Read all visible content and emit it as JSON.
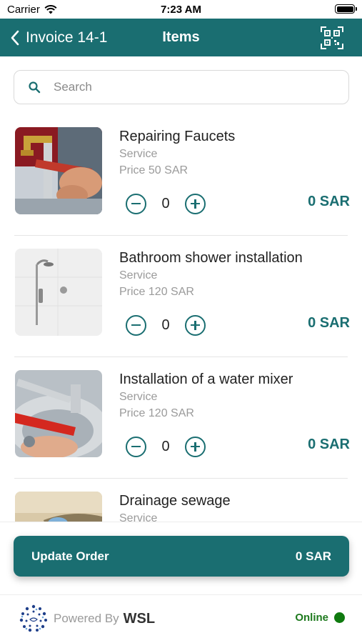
{
  "status_bar": {
    "carrier": "Carrier",
    "time": "7:23 AM"
  },
  "nav": {
    "back_label": "Invoice 14-1",
    "title": "Items"
  },
  "search": {
    "placeholder": "Search"
  },
  "items": [
    {
      "name": "Repairing Faucets",
      "category": "Service",
      "price": "Price 50 SAR",
      "quantity": "0",
      "total": "0 SAR"
    },
    {
      "name": "Bathroom shower installation",
      "category": "Service",
      "price": "Price 120 SAR",
      "quantity": "0",
      "total": "0 SAR"
    },
    {
      "name": "Installation of a water mixer",
      "category": "Service",
      "price": "Price 120 SAR",
      "quantity": "0",
      "total": "0 SAR"
    },
    {
      "name": "Drainage sewage",
      "category": "Service",
      "price": "",
      "quantity": "",
      "total": ""
    }
  ],
  "order_button": {
    "label": "Update Order",
    "amount": "0 SAR"
  },
  "footer": {
    "powered_by": "Powered By",
    "brand": "WSL",
    "status": "Online"
  },
  "colors": {
    "primary": "#1a6e71",
    "online": "#0f7a0f"
  },
  "icons": [
    "wifi-icon",
    "battery-icon",
    "chevron-left-icon",
    "qr-code-icon",
    "search-icon",
    "minus-icon",
    "plus-icon",
    "wsl-logo-icon"
  ]
}
